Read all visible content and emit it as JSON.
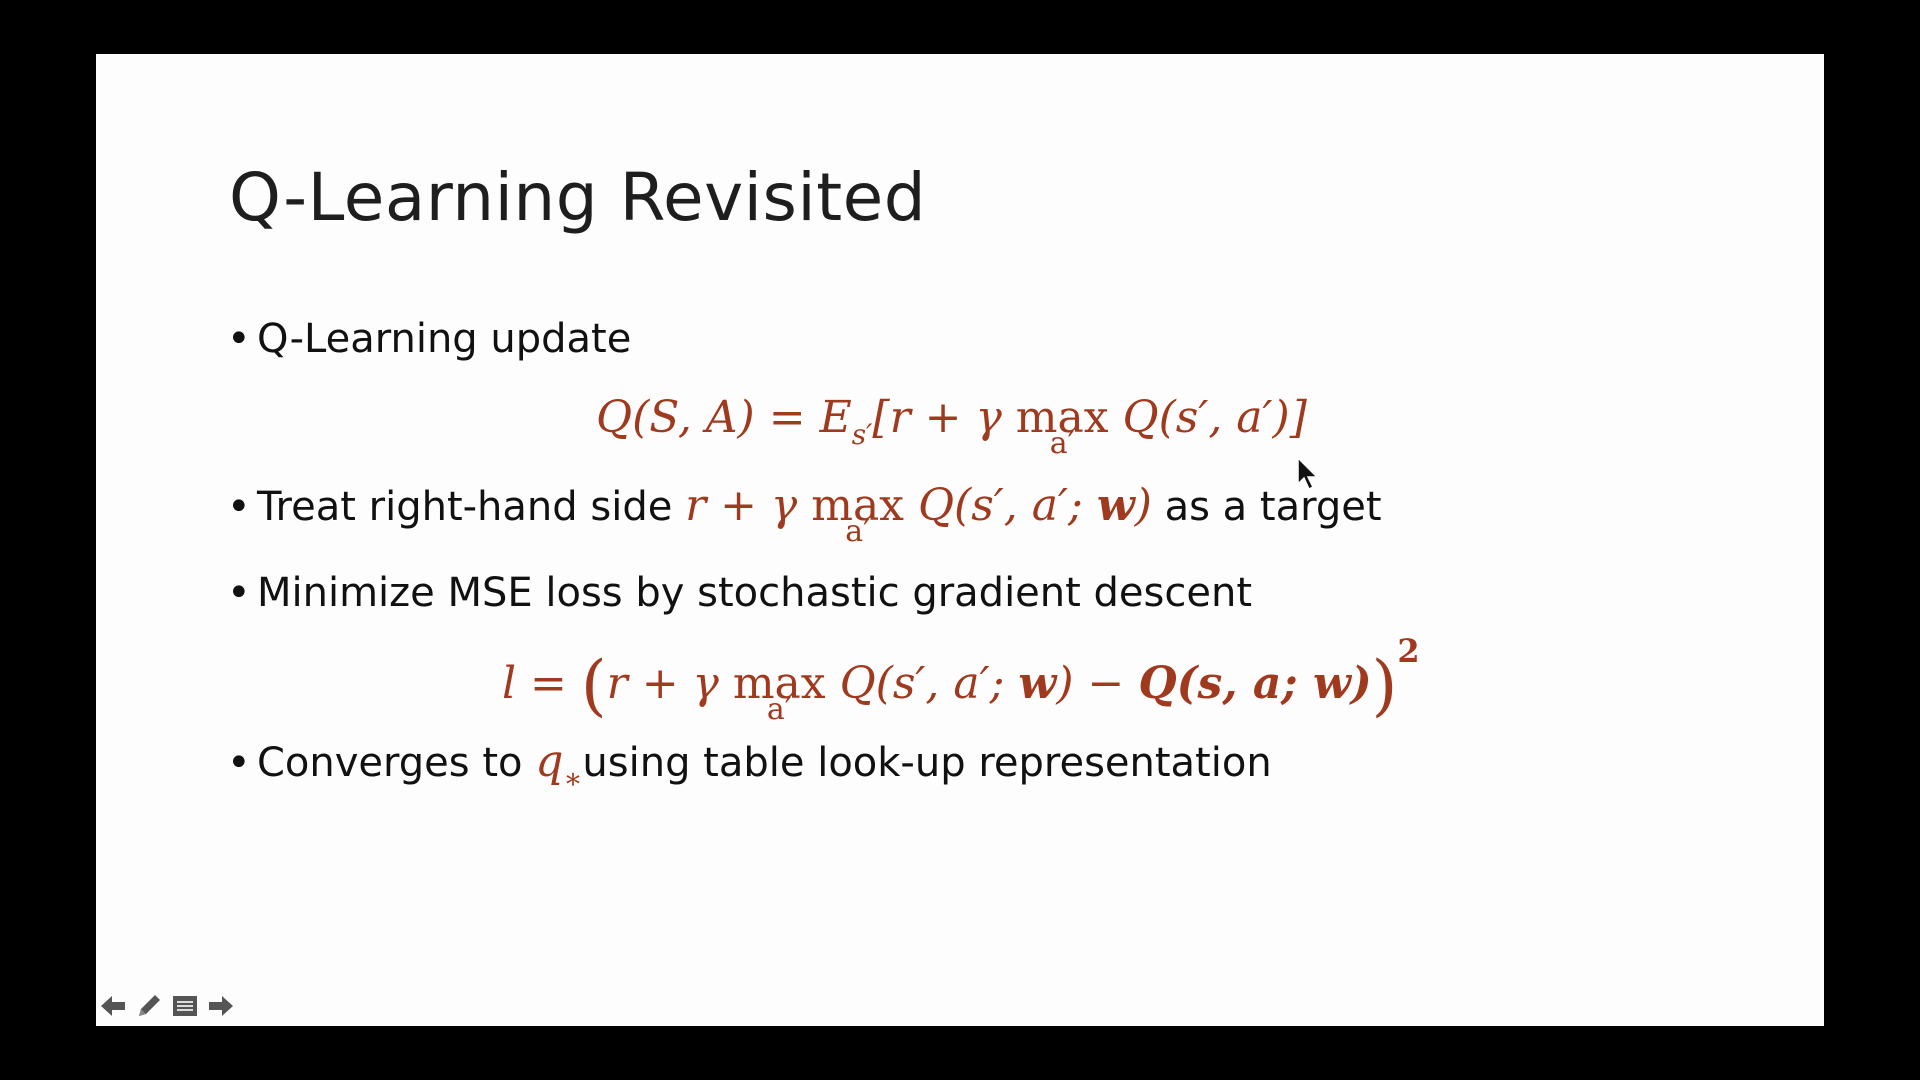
{
  "slide": {
    "title": "Q-Learning Revisited",
    "bullets": [
      "Q-Learning update",
      "Treat right-hand side",
      "as a target",
      "Minimize MSE loss by stochastic gradient descent",
      "Converges to",
      "using table look-up representation"
    ],
    "bullet_symbol": "•"
  },
  "formulas": {
    "update_lhs": "Q(S, A) = E",
    "update_sub": "s′",
    "update_rhs_a": "[r + γ ",
    "max": "max",
    "max_sub": "a′",
    "update_rhs_b": " Q(s′, a′)]",
    "target_a": "r + γ ",
    "target_b": " Q(s′, a′; ",
    "w": "w",
    "target_c": ")",
    "loss_l": "l = ",
    "lparen": "(",
    "loss_a": "r + γ ",
    "loss_b": " Q(s′, a′; ",
    "loss_c": ")  − ",
    "loss_bold": "Q(s, a; w)",
    "rparen": ")",
    "sq": "2",
    "qstar_q": "q",
    "qstar_sub": "∗"
  },
  "nav": {
    "icons": [
      "back-arrow-icon",
      "pen-icon",
      "menu-icon",
      "forward-arrow-icon"
    ]
  }
}
